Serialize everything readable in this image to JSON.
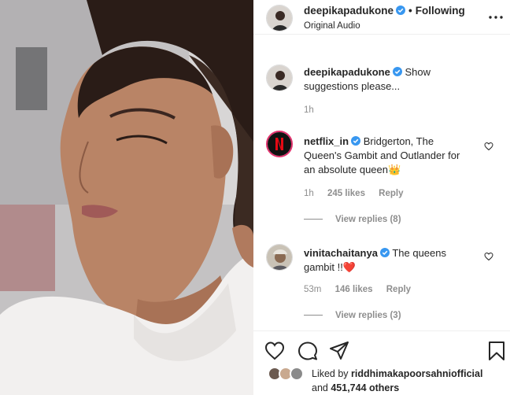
{
  "post": {
    "author": "deepikapadukone",
    "follow_status": "Following",
    "dot": "•",
    "audio": "Original Audio"
  },
  "caption": {
    "username": "deepikapadukone",
    "text": "Show suggestions please...",
    "time": "1h"
  },
  "comments": [
    {
      "username": "netflix_in",
      "text": "Bridgerton, The Queen's Gambit and Outlander for an absolute queen",
      "emoji": "👑",
      "time": "1h",
      "likes": "245 likes",
      "reply": "Reply",
      "view_replies": "View replies (8)"
    },
    {
      "username": "vinitachaitanya",
      "text": "The queens gambit !!",
      "emoji": "❤️",
      "time": "53m",
      "likes": "146 likes",
      "reply": "Reply",
      "view_replies": "View replies (3)"
    }
  ],
  "likes": {
    "prefix": "Liked by",
    "user": "riddhimakapoorsahniofficial",
    "and": "and",
    "count": "451,744 others"
  },
  "icons": {
    "verified": "verified-badge-icon",
    "more": "more-options-icon",
    "like": "heart-icon",
    "comment": "comment-icon",
    "share": "share-icon",
    "save": "bookmark-icon"
  },
  "colors": {
    "verified": "#3897f0",
    "heart_emoji": "#e0245e",
    "netflix": "#e50914"
  }
}
